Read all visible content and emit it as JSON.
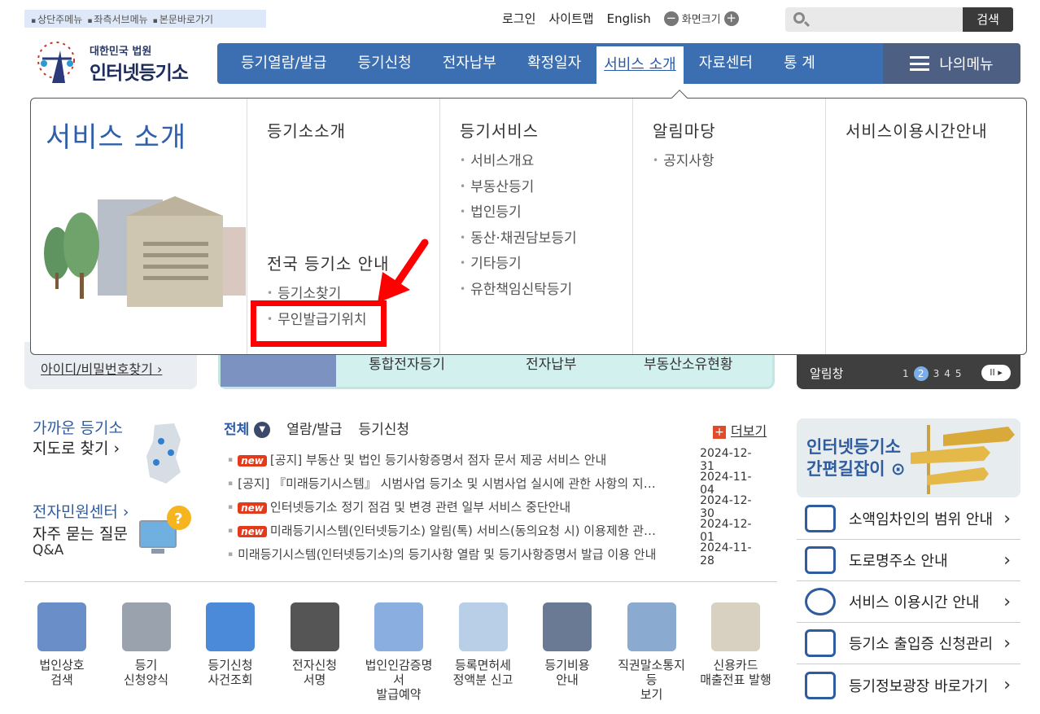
{
  "skip_links": [
    "상단주메뉴",
    "좌측서브메뉴",
    "본문바로가기"
  ],
  "util": {
    "login": "로그인",
    "sitemap": "사이트맵",
    "english": "English",
    "zoom": "화면크기",
    "zoom_minus": "−",
    "zoom_plus": "+"
  },
  "search": {
    "placeholder": "",
    "button": "검색"
  },
  "logo": {
    "line1": "대한민국 법원",
    "line2": "인터넷등기소"
  },
  "gnb": [
    "등기열람/발급",
    "등기신청",
    "전자납부",
    "확정일자",
    "서비스 소개",
    "자료센터",
    "통 계"
  ],
  "mymenu": "나의메뉴",
  "mega": {
    "title": "서비스 소개",
    "col1": {
      "heading": "등기소소개",
      "sub_heading": "전국 등기소 안내",
      "items": [
        "등기소찾기",
        "무인발급기위치"
      ]
    },
    "col2": {
      "heading": "등기서비스",
      "items": [
        "서비스개요",
        "부동산등기",
        "법인등기",
        "동산·채권담보등기",
        "기타등기",
        "유한책임신탁등기"
      ]
    },
    "col3": {
      "heading": "알림마당",
      "items": [
        "공지사항"
      ]
    },
    "col4": {
      "heading": "서비스이용시간안내"
    }
  },
  "find_id": "아이디/비밀번호찾기 ›",
  "quick": [
    "통합전자등기",
    "전자납부",
    "부동산소유현황"
  ],
  "notice_bar": {
    "label": "알림창",
    "pages": [
      "1",
      "2",
      "3",
      "4",
      "5"
    ],
    "current": "2",
    "pause": "II ▸"
  },
  "left": {
    "map_line1": "가까운 등기소",
    "map_line2": "지도로 찾기 ›",
    "civil": "전자민원센터 ›",
    "faq_line1": "자주 묻는 질문",
    "faq_line2": "Q&A"
  },
  "tabs": {
    "all": "전체",
    "view": "열람/발급",
    "apply": "등기신청",
    "more": "더보기"
  },
  "news": [
    {
      "new": true,
      "text": "[공지] 부동산 및 법인 등기사항증명서 점자 문서 제공 서비스 안내",
      "date": "2024-12-31"
    },
    {
      "new": false,
      "text": "[공지] 『미래등기시스템』 시범사업 등기소 및 시범사업 실시에 관한 사항의 지…",
      "date": "2024-11-04"
    },
    {
      "new": true,
      "text": "인터넷등기소 정기 점검 및 변경 관련 일부 서비스 중단안내",
      "date": "2024-12-30"
    },
    {
      "new": true,
      "text": "미래등기시스템(인터넷등기소) 알림(톡) 서비스(동의요청 시) 이용제한 관…",
      "date": "2024-12-01"
    },
    {
      "new": false,
      "text": "미래등기시스템(인터넷등기소)의 등기사항 열람 및 등기사항증명서 발급 이용 안내",
      "date": "2024-11-28"
    }
  ],
  "new_label": "new",
  "bottom_icons": [
    {
      "l1": "법인상호",
      "l2": "검색",
      "color": "#6a8fc8"
    },
    {
      "l1": "등기",
      "l2": "신청양식",
      "color": "#9aa3ad"
    },
    {
      "l1": "등기신청",
      "l2": "사건조회",
      "color": "#4a8ad8"
    },
    {
      "l1": "전자신청",
      "l2": "서명",
      "color": "#555555"
    },
    {
      "l1": "법인인감증명서",
      "l2": "발급예약",
      "color": "#8aaee0"
    },
    {
      "l1": "등록면허세",
      "l2": "정액분 신고",
      "color": "#b9cfe8"
    },
    {
      "l1": "등기비용",
      "l2": "안내",
      "color": "#6a7a94"
    },
    {
      "l1": "직권말소통지등",
      "l2": "보기",
      "color": "#8aaad0"
    },
    {
      "l1": "신용카드",
      "l2": "매출전표 발행",
      "color": "#d8d0c0"
    }
  ],
  "guide": {
    "l1": "인터넷등기소",
    "l2": "간편길잡이 ⊙"
  },
  "side_links": [
    "소액임차인의 범위 안내",
    "도로명주소 안내",
    "서비스 이용시간 안내",
    "등기소 출입증 신청관리",
    "등기정보광장 바로가기"
  ]
}
